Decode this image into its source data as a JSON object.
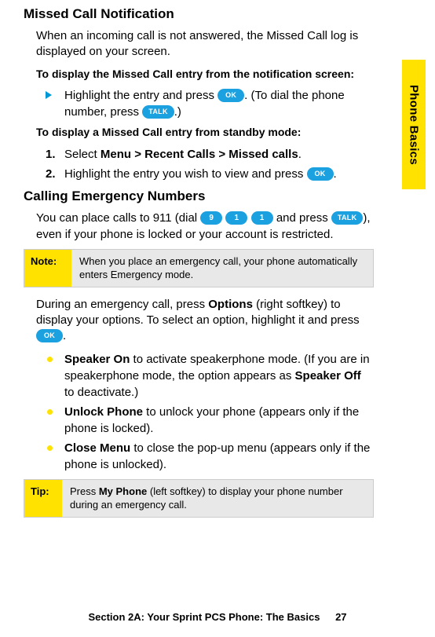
{
  "sideTab": "Phone Basics",
  "h1a": "Missed Call Notification",
  "p1": "When an incoming call is not answered, the Missed Call log is displayed on your screen.",
  "sub1": "To display the Missed Call entry from the notification screen:",
  "tri1_pre": "Highlight the entry and press ",
  "key_ok": "OK",
  "tri1_mid": ". (To dial the phone number, press ",
  "key_talk": "TALK",
  "tri1_post": ".)",
  "sub2": "To display a Missed Call entry from standby mode:",
  "step1_num": "1.",
  "step1_a": "Select ",
  "step1_b": "Menu",
  "step1_c": " > ",
  "step1_d": "Recent Calls",
  "step1_e": " > ",
  "step1_f": "Missed calls",
  "step1_g": ".",
  "step2_num": "2.",
  "step2_a": "Highlight the entry you wish to view and press ",
  "step2_b": ".",
  "h1b": "Calling Emergency Numbers",
  "p2_a": "You can place calls to 911 (dial ",
  "key_9": "9",
  "key_1": "1",
  "p2_b": " and press ",
  "p2_c": "), even if your phone is locked or your account is restricted.",
  "note_label": "Note:",
  "note_text": "When you place an emergency call, your phone automatically enters Emergency mode.",
  "p3_a": "During an emergency call, press ",
  "p3_b": "Options",
  "p3_c": " (right softkey) to display your options. To select an option, highlight it and press ",
  "p3_d": ".",
  "opt1_a": "Speaker On",
  "opt1_b": " to activate speakerphone mode. (If you are in speakerphone mode, the option appears as ",
  "opt1_c": "Speaker Off",
  "opt1_d": " to deactivate.)",
  "opt2_a": "Unlock Phone",
  "opt2_b": " to unlock your phone (appears only if the phone is locked).",
  "opt3_a": "Close Menu",
  "opt3_b": " to close the pop-up menu (appears only if the phone is unlocked).",
  "tip_label": "Tip:",
  "tip_a": "Press ",
  "tip_b": "My Phone",
  "tip_c": " (left softkey) to display your phone number during an emergency call.",
  "footer_text": "Section 2A: Your Sprint PCS Phone: The Basics",
  "footer_page": "27"
}
